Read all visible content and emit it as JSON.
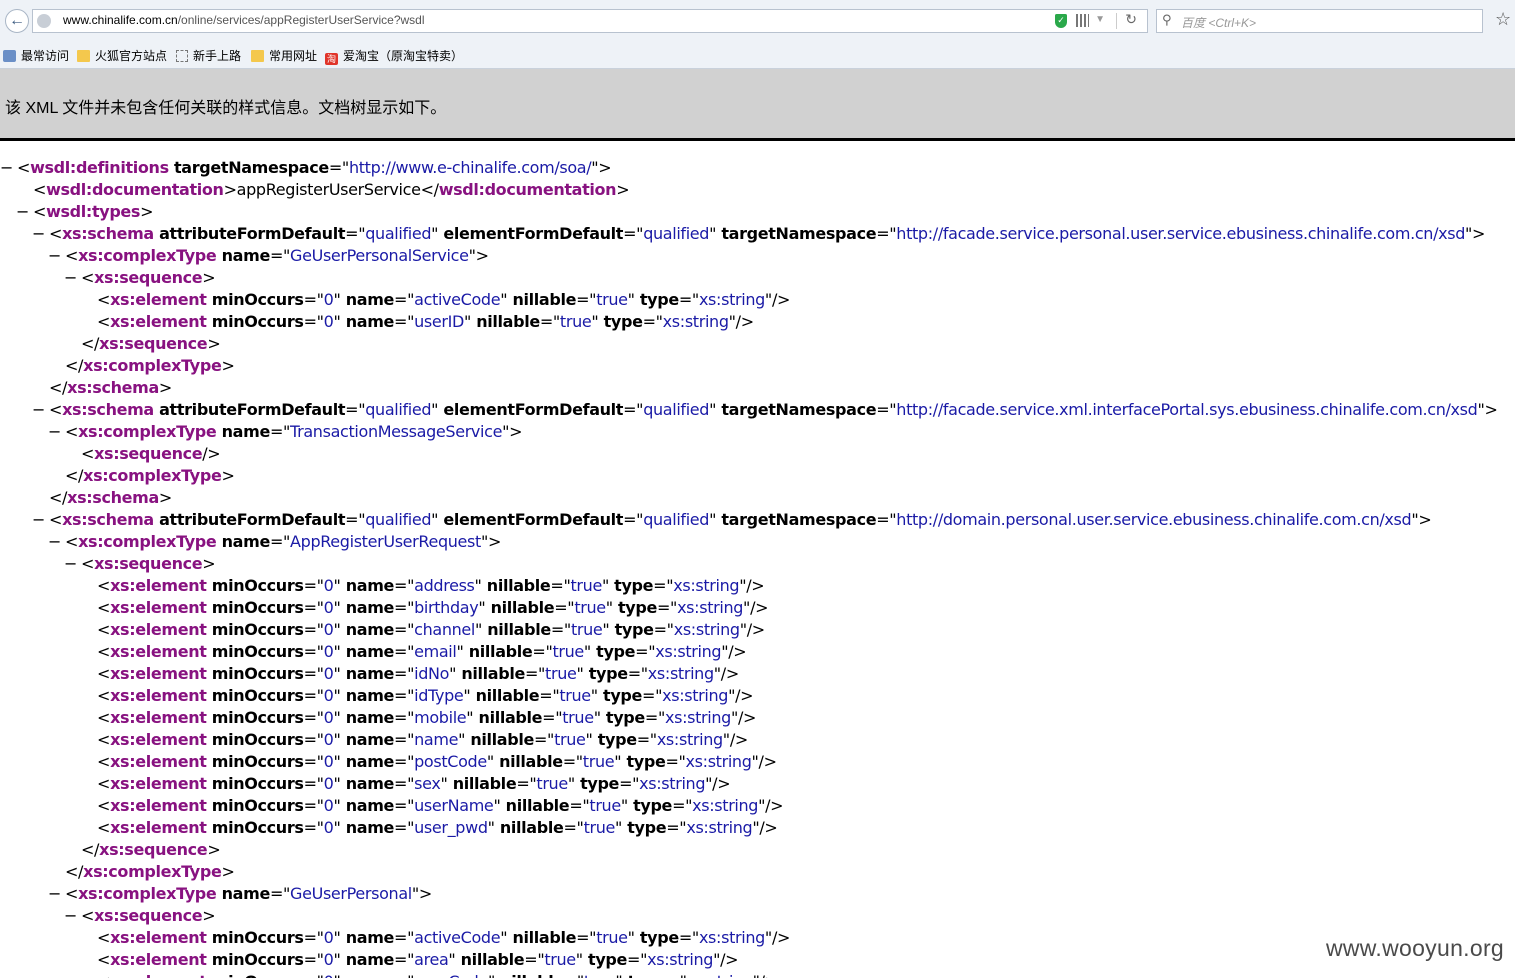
{
  "navbar": {
    "url_host": "www.chinalife.com.cn",
    "url_path": "/online/services/appRegisterUserService?wsdl",
    "search_placeholder": "百度 <Ctrl+K>"
  },
  "bookmarks": [
    {
      "label": "最常访问",
      "icon": "most-visited-icon"
    },
    {
      "label": "火狐官方站点",
      "icon": "folder-icon"
    },
    {
      "label": "新手上路",
      "icon": "page-icon"
    },
    {
      "label": "常用网址",
      "icon": "folder-icon"
    },
    {
      "label": "爱淘宝（原淘宝特卖）",
      "icon": "taobao-icon",
      "icon_text": "淘"
    }
  ],
  "info_message": "该 XML 文件并未包含任何关联的样式信息。文档树显示如下。",
  "xml_lines": [
    {
      "depth": 0,
      "expander": "−",
      "type": "open",
      "tag": "wsdl:definitions",
      "attrs": [
        [
          "targetNamespace",
          "http://www.e-chinalife.com/soa/"
        ]
      ]
    },
    {
      "depth": 1,
      "type": "text",
      "tag": "wsdl:documentation",
      "text": "appRegisterUserService"
    },
    {
      "depth": 1,
      "expander": "−",
      "type": "open",
      "tag": "wsdl:types",
      "attrs": []
    },
    {
      "depth": 2,
      "expander": "−",
      "type": "open",
      "tag": "xs:schema",
      "attrs": [
        [
          "attributeFormDefault",
          "qualified"
        ],
        [
          "elementFormDefault",
          "qualified"
        ],
        [
          "targetNamespace",
          "http://facade.service.personal.user.service.ebusiness.chinalife.com.cn/xsd"
        ]
      ]
    },
    {
      "depth": 3,
      "expander": "−",
      "type": "open",
      "tag": "xs:complexType",
      "attrs": [
        [
          "name",
          "GeUserPersonalService"
        ]
      ]
    },
    {
      "depth": 4,
      "expander": "−",
      "type": "open",
      "tag": "xs:sequence",
      "attrs": []
    },
    {
      "depth": 5,
      "type": "self",
      "tag": "xs:element",
      "attrs": [
        [
          "minOccurs",
          "0"
        ],
        [
          "name",
          "activeCode"
        ],
        [
          "nillable",
          "true"
        ],
        [
          "type",
          "xs:string"
        ]
      ]
    },
    {
      "depth": 5,
      "type": "self",
      "tag": "xs:element",
      "attrs": [
        [
          "minOccurs",
          "0"
        ],
        [
          "name",
          "userID"
        ],
        [
          "nillable",
          "true"
        ],
        [
          "type",
          "xs:string"
        ]
      ]
    },
    {
      "depth": 4,
      "type": "close",
      "tag": "xs:sequence"
    },
    {
      "depth": 3,
      "type": "close",
      "tag": "xs:complexType"
    },
    {
      "depth": 2,
      "type": "close",
      "tag": "xs:schema"
    },
    {
      "depth": 2,
      "expander": "−",
      "type": "open",
      "tag": "xs:schema",
      "attrs": [
        [
          "attributeFormDefault",
          "qualified"
        ],
        [
          "elementFormDefault",
          "qualified"
        ],
        [
          "targetNamespace",
          "http://facade.service.xml.interfacePortal.sys.ebusiness.chinalife.com.cn/xsd"
        ]
      ]
    },
    {
      "depth": 3,
      "expander": "−",
      "type": "open",
      "tag": "xs:complexType",
      "attrs": [
        [
          "name",
          "TransactionMessageService"
        ]
      ]
    },
    {
      "depth": 4,
      "type": "self",
      "tag": "xs:sequence",
      "attrs": []
    },
    {
      "depth": 3,
      "type": "close",
      "tag": "xs:complexType"
    },
    {
      "depth": 2,
      "type": "close",
      "tag": "xs:schema"
    },
    {
      "depth": 2,
      "expander": "−",
      "type": "open",
      "tag": "xs:schema",
      "attrs": [
        [
          "attributeFormDefault",
          "qualified"
        ],
        [
          "elementFormDefault",
          "qualified"
        ],
        [
          "targetNamespace",
          "http://domain.personal.user.service.ebusiness.chinalife.com.cn/xsd"
        ]
      ]
    },
    {
      "depth": 3,
      "expander": "−",
      "type": "open",
      "tag": "xs:complexType",
      "attrs": [
        [
          "name",
          "AppRegisterUserRequest"
        ]
      ]
    },
    {
      "depth": 4,
      "expander": "−",
      "type": "open",
      "tag": "xs:sequence",
      "attrs": []
    },
    {
      "depth": 5,
      "type": "self",
      "tag": "xs:element",
      "attrs": [
        [
          "minOccurs",
          "0"
        ],
        [
          "name",
          "address"
        ],
        [
          "nillable",
          "true"
        ],
        [
          "type",
          "xs:string"
        ]
      ]
    },
    {
      "depth": 5,
      "type": "self",
      "tag": "xs:element",
      "attrs": [
        [
          "minOccurs",
          "0"
        ],
        [
          "name",
          "birthday"
        ],
        [
          "nillable",
          "true"
        ],
        [
          "type",
          "xs:string"
        ]
      ]
    },
    {
      "depth": 5,
      "type": "self",
      "tag": "xs:element",
      "attrs": [
        [
          "minOccurs",
          "0"
        ],
        [
          "name",
          "channel"
        ],
        [
          "nillable",
          "true"
        ],
        [
          "type",
          "xs:string"
        ]
      ]
    },
    {
      "depth": 5,
      "type": "self",
      "tag": "xs:element",
      "attrs": [
        [
          "minOccurs",
          "0"
        ],
        [
          "name",
          "email"
        ],
        [
          "nillable",
          "true"
        ],
        [
          "type",
          "xs:string"
        ]
      ]
    },
    {
      "depth": 5,
      "type": "self",
      "tag": "xs:element",
      "attrs": [
        [
          "minOccurs",
          "0"
        ],
        [
          "name",
          "idNo"
        ],
        [
          "nillable",
          "true"
        ],
        [
          "type",
          "xs:string"
        ]
      ]
    },
    {
      "depth": 5,
      "type": "self",
      "tag": "xs:element",
      "attrs": [
        [
          "minOccurs",
          "0"
        ],
        [
          "name",
          "idType"
        ],
        [
          "nillable",
          "true"
        ],
        [
          "type",
          "xs:string"
        ]
      ]
    },
    {
      "depth": 5,
      "type": "self",
      "tag": "xs:element",
      "attrs": [
        [
          "minOccurs",
          "0"
        ],
        [
          "name",
          "mobile"
        ],
        [
          "nillable",
          "true"
        ],
        [
          "type",
          "xs:string"
        ]
      ]
    },
    {
      "depth": 5,
      "type": "self",
      "tag": "xs:element",
      "attrs": [
        [
          "minOccurs",
          "0"
        ],
        [
          "name",
          "name"
        ],
        [
          "nillable",
          "true"
        ],
        [
          "type",
          "xs:string"
        ]
      ]
    },
    {
      "depth": 5,
      "type": "self",
      "tag": "xs:element",
      "attrs": [
        [
          "minOccurs",
          "0"
        ],
        [
          "name",
          "postCode"
        ],
        [
          "nillable",
          "true"
        ],
        [
          "type",
          "xs:string"
        ]
      ]
    },
    {
      "depth": 5,
      "type": "self",
      "tag": "xs:element",
      "attrs": [
        [
          "minOccurs",
          "0"
        ],
        [
          "name",
          "sex"
        ],
        [
          "nillable",
          "true"
        ],
        [
          "type",
          "xs:string"
        ]
      ]
    },
    {
      "depth": 5,
      "type": "self",
      "tag": "xs:element",
      "attrs": [
        [
          "minOccurs",
          "0"
        ],
        [
          "name",
          "userName"
        ],
        [
          "nillable",
          "true"
        ],
        [
          "type",
          "xs:string"
        ]
      ]
    },
    {
      "depth": 5,
      "type": "self",
      "tag": "xs:element",
      "attrs": [
        [
          "minOccurs",
          "0"
        ],
        [
          "name",
          "user_pwd"
        ],
        [
          "nillable",
          "true"
        ],
        [
          "type",
          "xs:string"
        ]
      ]
    },
    {
      "depth": 4,
      "type": "close",
      "tag": "xs:sequence"
    },
    {
      "depth": 3,
      "type": "close",
      "tag": "xs:complexType"
    },
    {
      "depth": 3,
      "expander": "−",
      "type": "open",
      "tag": "xs:complexType",
      "attrs": [
        [
          "name",
          "GeUserPersonal"
        ]
      ]
    },
    {
      "depth": 4,
      "expander": "−",
      "type": "open",
      "tag": "xs:sequence",
      "attrs": []
    },
    {
      "depth": 5,
      "type": "self",
      "tag": "xs:element",
      "attrs": [
        [
          "minOccurs",
          "0"
        ],
        [
          "name",
          "activeCode"
        ],
        [
          "nillable",
          "true"
        ],
        [
          "type",
          "xs:string"
        ]
      ]
    },
    {
      "depth": 5,
      "type": "self",
      "tag": "xs:element",
      "attrs": [
        [
          "minOccurs",
          "0"
        ],
        [
          "name",
          "area"
        ],
        [
          "nillable",
          "true"
        ],
        [
          "type",
          "xs:string"
        ]
      ]
    },
    {
      "depth": 5,
      "type": "self",
      "tag": "xs:element",
      "attrs": [
        [
          "minOccurs",
          "0"
        ],
        [
          "name",
          "areaCode"
        ],
        [
          "nillable",
          "true"
        ],
        [
          "type",
          "xs:string"
        ]
      ]
    }
  ],
  "watermark": "www.wooyun.org",
  "colors": {
    "tag": "#881280",
    "attr_value": "#1a1aa6",
    "info_bar_bg": "#d1d1d1"
  }
}
